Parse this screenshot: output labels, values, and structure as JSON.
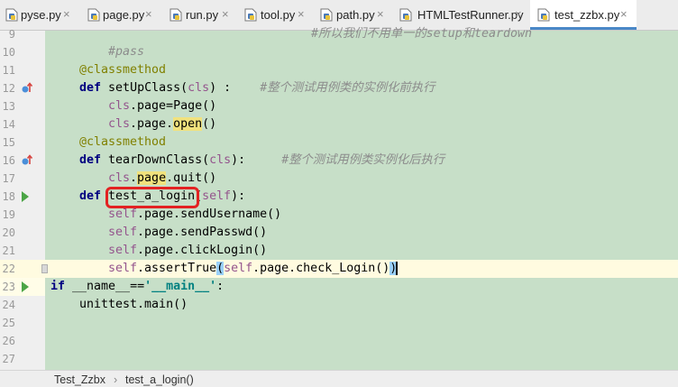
{
  "tabs": [
    {
      "label": "pyse.py",
      "active": false
    },
    {
      "label": "page.py",
      "active": false
    },
    {
      "label": "run.py",
      "active": false
    },
    {
      "label": "tool.py",
      "active": false
    },
    {
      "label": "path.py",
      "active": false
    },
    {
      "label": "HTMLTestRunner.py",
      "active": false
    },
    {
      "label": "test_zzbx.py",
      "active": true
    }
  ],
  "close_glyph": "×",
  "lines": [
    {
      "num": "9"
    },
    {
      "num": "10"
    },
    {
      "num": "11"
    },
    {
      "num": "12"
    },
    {
      "num": "13"
    },
    {
      "num": "14"
    },
    {
      "num": "15"
    },
    {
      "num": "16"
    },
    {
      "num": "17"
    },
    {
      "num": "18"
    },
    {
      "num": "19"
    },
    {
      "num": "20"
    },
    {
      "num": "21"
    },
    {
      "num": "22"
    },
    {
      "num": "23"
    },
    {
      "num": "24"
    },
    {
      "num": "25"
    },
    {
      "num": "26"
    },
    {
      "num": "27"
    }
  ],
  "code": {
    "l9_comment": "#所以我们不用单一的setup和teardown",
    "l10_comment": "#pass",
    "decorator": "@classmethod",
    "kw_def": "def",
    "kw_if": "if",
    "setup_name": "setUpClass(",
    "cls": "cls",
    "setup_tail": ") :",
    "setup_comment": "#整个测试用例类的实例化前执行",
    "l13_rest": ".page=Page()",
    "l14_mid": ".page.",
    "l14_hl": "open",
    "l14_tail": "()",
    "teardown_name": "tearDownClass(",
    "teardown_tail": "):",
    "teardown_comment": "#整个测试用例类实例化后执行",
    "l17_dot": ".",
    "l17_hl": "page",
    "l17_tail": ".quit()",
    "login_name": "test_a_login",
    "paren_open": "(",
    "self": "self",
    "login_tail": "):",
    "l19_rest": ".page.sendUsername()",
    "l20_rest": ".page.sendPasswd()",
    "l21_rest": ".page.clickLogin()",
    "l22_mid": ".assertTrue",
    "l22_inner": ".page.check_Login()",
    "paren_close": ")",
    "l23_mid": " __name__==",
    "l23_str": "'__main__'",
    "l23_tail": ":",
    "l24": "unittest.main()"
  },
  "breadcrumb": {
    "class_name": "Test_Zzbx",
    "separator": "›",
    "method_name": "test_a_login()"
  },
  "colors": {
    "editor_bg": "#c7dfc8",
    "keyword": "#000080",
    "self": "#94558d",
    "comment": "#8c8c8c",
    "string": "#008080",
    "highlight_box": "#e32222"
  }
}
